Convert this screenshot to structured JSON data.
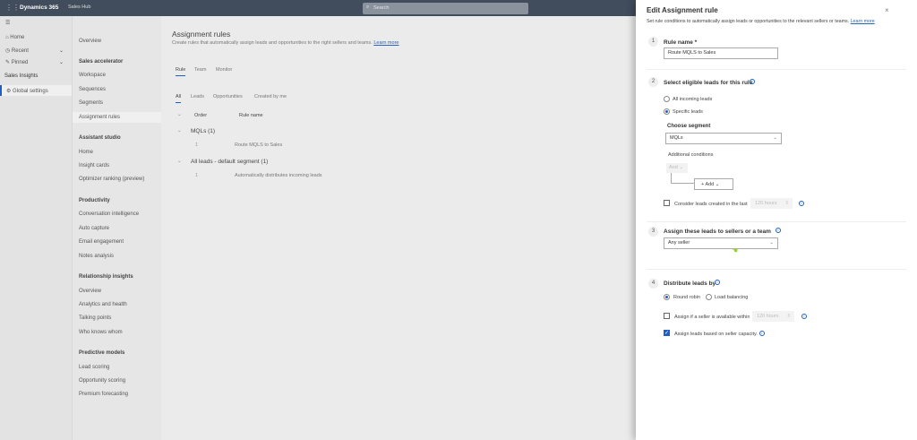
{
  "topbar": {
    "app_name": "Dynamics 365",
    "area": "Sales Hub",
    "search_placeholder": "Search"
  },
  "leftnav": {
    "items": [
      {
        "label": "Home"
      },
      {
        "label": "Recent"
      },
      {
        "label": "Pinned"
      }
    ],
    "section": "Sales Insights",
    "selected": "Global settings"
  },
  "subnav": [
    {
      "type": "item",
      "label": "Overview"
    },
    {
      "type": "header",
      "label": "Sales accelerator"
    },
    {
      "type": "item",
      "label": "Workspace"
    },
    {
      "type": "item",
      "label": "Sequences"
    },
    {
      "type": "item",
      "label": "Segments"
    },
    {
      "type": "item",
      "label": "Assignment rules",
      "selected": true
    },
    {
      "type": "header",
      "label": "Assistant studio"
    },
    {
      "type": "item",
      "label": "Home"
    },
    {
      "type": "item",
      "label": "Insight cards"
    },
    {
      "type": "item",
      "label": "Optimizer ranking (preview)"
    },
    {
      "type": "header",
      "label": "Productivity"
    },
    {
      "type": "item",
      "label": "Conversation intelligence"
    },
    {
      "type": "item",
      "label": "Auto capture"
    },
    {
      "type": "item",
      "label": "Email engagement"
    },
    {
      "type": "item",
      "label": "Notes analysis"
    },
    {
      "type": "header",
      "label": "Relationship insights"
    },
    {
      "type": "item",
      "label": "Overview"
    },
    {
      "type": "item",
      "label": "Analytics and health"
    },
    {
      "type": "item",
      "label": "Talking points"
    },
    {
      "type": "item",
      "label": "Who knows whom"
    },
    {
      "type": "header",
      "label": "Predictive models"
    },
    {
      "type": "item",
      "label": "Lead scoring"
    },
    {
      "type": "item",
      "label": "Opportunity scoring"
    },
    {
      "type": "item",
      "label": "Premium forecasting"
    }
  ],
  "main": {
    "title": "Assignment rules",
    "subtitle": "Create rules that automatically assign leads and opportunities to the right sellers and teams.",
    "learn_more": "Learn more",
    "tabs": [
      "Rule",
      "Team",
      "Monitor"
    ],
    "filters": [
      "All",
      "Leads",
      "Opportunities",
      "Created by me"
    ],
    "columns": [
      "Order",
      "Rule name"
    ],
    "groups": [
      {
        "name": "MQLs (1)",
        "rows": [
          {
            "order": "1",
            "rule": "Route MQLS to Sales"
          }
        ]
      },
      {
        "name": "All leads - default segment (1)",
        "rows": [
          {
            "order": "1",
            "rule": "Automatically distributes incoming leads"
          }
        ]
      }
    ]
  },
  "panel": {
    "title": "Edit Assignment rule",
    "subtitle": "Set rule conditions to automatically assign leads or opportunities to the relevant sellers or teams.",
    "learn_more": "Learn more",
    "step1": {
      "num": "1",
      "label": "Rule name *",
      "value": "Route MQLS to Sales"
    },
    "step2": {
      "num": "2",
      "label": "Select eligible leads for this rule",
      "opt_all": "All incoming leads",
      "opt_specific": "Specific leads",
      "selected": "Specific leads",
      "segment_label": "Choose segment",
      "segment_value": "MQLs",
      "additional": "Additional conditions",
      "and_label": "And",
      "add_label": "Add",
      "consider_label": "Consider leads created in the last",
      "consider_value": "120 hours",
      "consider_checked": false
    },
    "step3": {
      "num": "3",
      "label": "Assign these leads to sellers or a team",
      "value": "Any seller"
    },
    "step4": {
      "num": "4",
      "label": "Distribute leads by",
      "opt_rr": "Round robin",
      "opt_lb": "Load balancing",
      "selected": "Round robin",
      "avail_label": "Assign if a seller is available within",
      "avail_value": "120 hours",
      "avail_checked": false,
      "capacity_label": "Assign leads based on seller capacity.",
      "capacity_checked": true
    }
  },
  "colors": {
    "topbar": "#414c5d",
    "accent": "#1f5fc4",
    "cursor": "#9acd32"
  }
}
